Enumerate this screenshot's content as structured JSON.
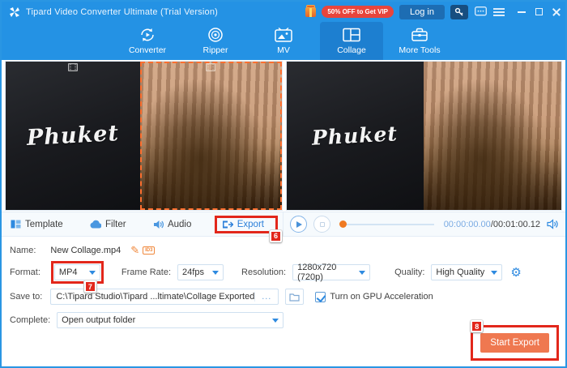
{
  "titlebar": {
    "title": "Tipard Video Converter Ultimate (Trial Version)",
    "promo": "50% OFF to Get VIP",
    "login": "Log in"
  },
  "nav": {
    "tabs": [
      {
        "label": "Converter"
      },
      {
        "label": "Ripper"
      },
      {
        "label": "MV"
      },
      {
        "label": "Collage"
      },
      {
        "label": "More Tools"
      }
    ],
    "active_tab": "Collage"
  },
  "preview": {
    "caption_left_editor": "Phuket",
    "caption_left_preview": "Phuket"
  },
  "toolbar": {
    "tabs": [
      {
        "label": "Template"
      },
      {
        "label": "Filter"
      },
      {
        "label": "Audio"
      },
      {
        "label": "Export"
      }
    ],
    "export_callout": "6"
  },
  "player": {
    "current": "00:00:00.00",
    "separator": "/",
    "total": "00:01:00.12"
  },
  "settings": {
    "name_label": "Name:",
    "name_value": "New Collage.mp4",
    "format_label": "Format:",
    "format_value": "MP4",
    "format_callout": "7",
    "framerate_label": "Frame Rate:",
    "framerate_value": "24fps",
    "resolution_label": "Resolution:",
    "resolution_value": "1280x720 (720p)",
    "quality_label": "Quality:",
    "quality_value": "High Quality",
    "saveto_label": "Save to:",
    "saveto_value": "C:\\Tipard Studio\\Tipard ...ltimate\\Collage Exported",
    "browse_dots": "...",
    "gpu_label": "Turn on GPU Acceleration",
    "complete_label": "Complete:",
    "complete_value": "Open output folder",
    "start_button": "Start Export",
    "start_callout": "8"
  },
  "icons": {
    "pencil": "✎",
    "id3": "ID3",
    "gear": "⚙"
  },
  "colors": {
    "titlebar_blue": "#2492e4",
    "active_tab_blue": "#1d7fd0",
    "callout_red": "#e2271b",
    "start_orange": "#ef7850",
    "accent_blue": "#2e8ae0",
    "selection_dash_orange": "#ff6f2e"
  }
}
